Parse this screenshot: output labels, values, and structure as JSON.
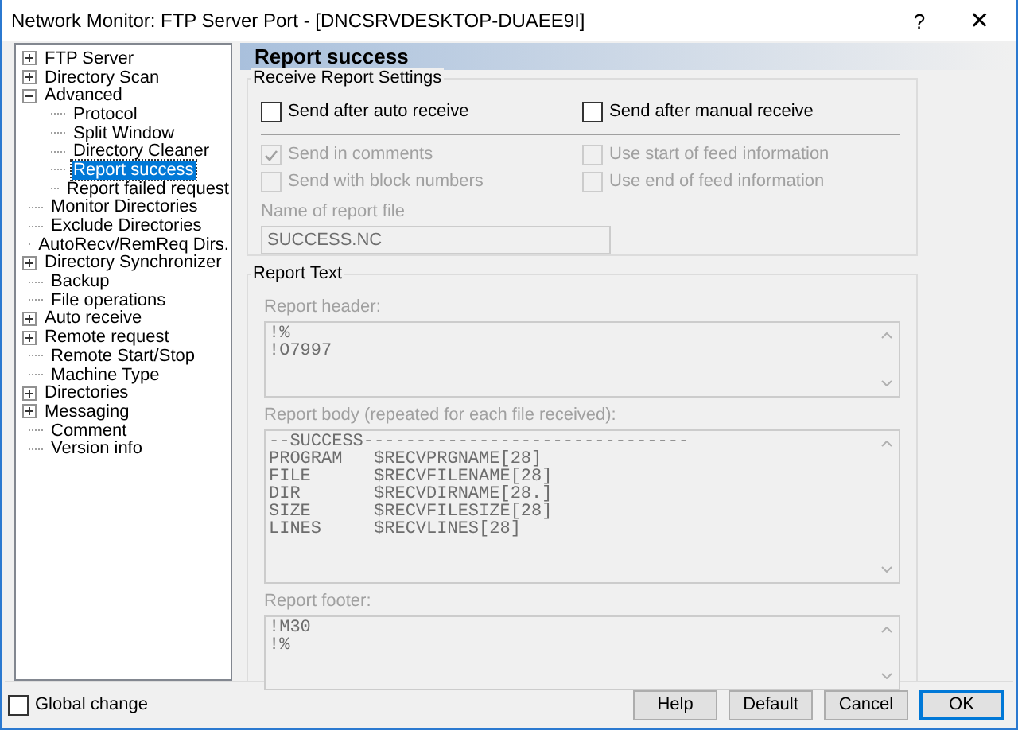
{
  "window": {
    "title": "Network Monitor: FTP Server Port - [DNCSRVDESKTOP-DUAEE9I]",
    "help_glyph": "?",
    "close_glyph": "✕"
  },
  "tree": [
    {
      "label": "FTP Server",
      "expanded": false,
      "selected": false
    },
    {
      "label": "Directory Scan",
      "expanded": false,
      "selected": false
    },
    {
      "label": "Advanced",
      "expanded": true,
      "selected": false,
      "children": [
        {
          "label": "Protocol",
          "selected": false
        },
        {
          "label": "Split Window",
          "selected": false
        },
        {
          "label": "Directory Cleaner",
          "selected": false
        },
        {
          "label": "Report success",
          "selected": true
        },
        {
          "label": "Report failed request",
          "selected": false
        }
      ]
    },
    {
      "label": "Monitor Directories",
      "selected": false
    },
    {
      "label": "Exclude Directories",
      "selected": false
    },
    {
      "label": "AutoRecv/RemReq Dirs.",
      "selected": false
    },
    {
      "label": "Directory Synchronizer",
      "expanded": false,
      "selected": false
    },
    {
      "label": "Backup",
      "selected": false
    },
    {
      "label": "File operations",
      "selected": false
    },
    {
      "label": "Auto receive",
      "expanded": false,
      "selected": false
    },
    {
      "label": "Remote request",
      "expanded": false,
      "selected": false
    },
    {
      "label": "Remote Start/Stop",
      "selected": false
    },
    {
      "label": "Machine Type",
      "selected": false
    },
    {
      "label": "Directories",
      "expanded": false,
      "selected": false
    },
    {
      "label": "Messaging",
      "expanded": false,
      "selected": false
    },
    {
      "label": "Comment",
      "selected": false
    },
    {
      "label": "Version info",
      "selected": false
    }
  ],
  "page_title": "Report success",
  "settings": {
    "legend": "Receive Report Settings",
    "top_checkboxes": [
      {
        "label": "Send after auto receive",
        "checked": false,
        "disabled": false
      },
      {
        "label": "Send after manual receive",
        "checked": false,
        "disabled": false
      }
    ],
    "options": [
      {
        "label": "Send in comments",
        "checked": true,
        "disabled": true
      },
      {
        "label": "Use start of feed information",
        "checked": false,
        "disabled": true
      },
      {
        "label": "Send with block numbers",
        "checked": false,
        "disabled": true
      },
      {
        "label": "Use end of feed information",
        "checked": false,
        "disabled": true
      }
    ],
    "file_label": "Name of report file",
    "file_value": "SUCCESS.NC"
  },
  "report_text": {
    "legend": "Report Text",
    "fields": [
      {
        "label": "Report header:",
        "value": "!%\n!O7997"
      },
      {
        "label": "Report body (repeated for each file received):",
        "value": "--SUCCESS-------------------------------\nPROGRAM   $RECVPRGNAME[28]\nFILE      $RECVFILENAME[28]\nDIR       $RECVDIRNAME[28.]\nSIZE      $RECVFILESIZE[28]\nLINES     $RECVLINES[28]"
      },
      {
        "label": "Report footer:",
        "value": "!M30\n!%"
      }
    ]
  },
  "global_change": {
    "label": "Global change",
    "checked": false
  },
  "buttons": [
    {
      "label": "Help",
      "default": false
    },
    {
      "label": "Default",
      "default": false
    },
    {
      "label": "Cancel",
      "default": false
    },
    {
      "label": "OK",
      "default": true
    }
  ]
}
